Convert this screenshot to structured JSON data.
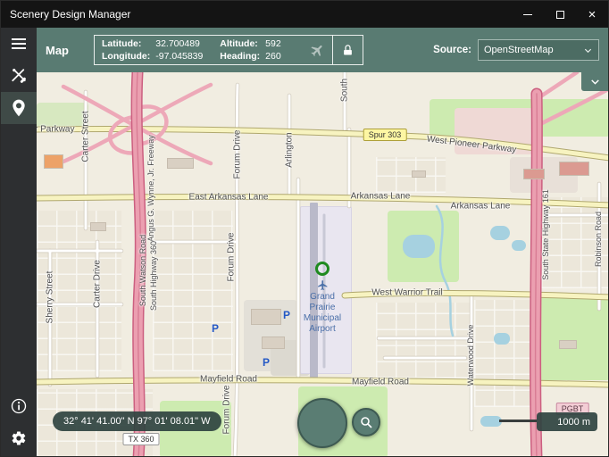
{
  "window": {
    "title": "Scenery Design Manager",
    "close_glyph": "×"
  },
  "toolbar": {
    "title": "Map",
    "telemetry": {
      "latitude_label": "Latitude:",
      "latitude": "32.700489",
      "longitude_label": "Longitude:",
      "longitude": "-97.045839",
      "altitude_label": "Altitude:",
      "altitude": "592",
      "heading_label": "Heading:",
      "heading": "260"
    },
    "source_label": "Source:",
    "source_value": "OpenStreetMap"
  },
  "map": {
    "labels": {
      "pioneer_left": "West Pioneer Parkway",
      "spur": "Spur 303",
      "pioneer": "West Pioneer Parkway",
      "arkansas_east": "East Arkansas Lane",
      "arkansas_mid": "Arkansas Lane",
      "arkansas_right": "Arkansas Lane",
      "warrior": "West Warrior Trail",
      "mayfield_left": "Mayfield Road",
      "mayfield_right": "Mayfield Road",
      "carter_street": "Carter Street",
      "carter_drive": "Carter Drive",
      "sherry_street": "Sherry Street",
      "forum_drive": "Forum Drive",
      "arlington": "Arlington",
      "south": "South",
      "angus": "Angus G. Wynne, Jr. Freeway",
      "watson": "South Watson Road",
      "hwy360": "South Highway 360",
      "hwy161": "South State Highway 161",
      "robinson": "Robinson Road",
      "waterwood": "Waterwood Drive",
      "parking": "P"
    },
    "airport_name": "Grand Prairie Municipal Airport",
    "shields": {
      "tx360": "TX 360",
      "pgbt": "PGBT"
    },
    "coordinates": "32° 41' 41.00\" N 97° 01' 08.01\" W",
    "scale": "1000 m"
  },
  "colors": {
    "accent_teal": "#597b72",
    "motorway_pink": "#eb9fb0",
    "road_yellow": "#f7f3c0",
    "marker_green": "#1f8a1f"
  }
}
